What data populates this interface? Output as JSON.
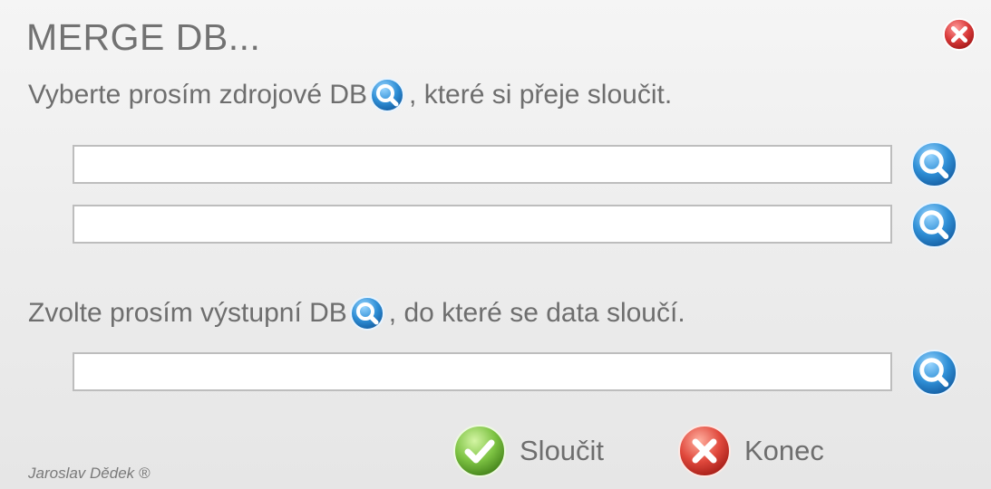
{
  "window": {
    "title": "MERGE DB..."
  },
  "source": {
    "label_before": "Vyberte prosím zdrojové DB",
    "label_after": ", které si přeje sloučit.",
    "fields": [
      {
        "value": ""
      },
      {
        "value": ""
      }
    ]
  },
  "output": {
    "label_before": "Zvolte prosím výstupní DB",
    "label_after": ", do které se data sloučí.",
    "field": {
      "value": ""
    }
  },
  "actions": {
    "merge_label": "Sloučit",
    "exit_label": "Konec"
  },
  "footer": {
    "author": "Jaroslav Dědek ®"
  },
  "colors": {
    "search_blue": "#2f8fd6",
    "close_red": "#d93a3a",
    "confirm_green": "#7cc242"
  },
  "icons": {
    "close": "close-icon",
    "search": "magnifier-icon",
    "confirm": "check-icon",
    "cancel": "cancel-icon"
  }
}
